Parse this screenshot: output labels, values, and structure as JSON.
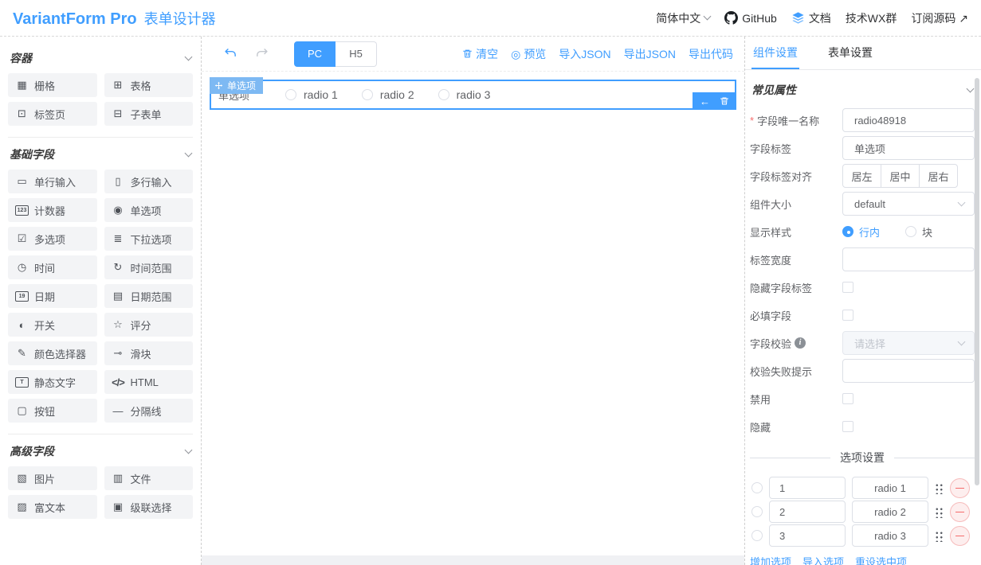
{
  "header": {
    "brand": "VariantForm Pro",
    "subtitle": "表单设计器",
    "language": "简体中文",
    "nav_github": "GitHub",
    "nav_docs": "文档",
    "nav_wx": "技术WX群",
    "nav_source": "订阅源码 ↗"
  },
  "sidebar": {
    "sections": [
      {
        "title": "容器",
        "items": [
          {
            "label": "栅格",
            "icon": "grid-icon"
          },
          {
            "label": "表格",
            "icon": "table-icon"
          },
          {
            "label": "标签页",
            "icon": "tabs-icon"
          },
          {
            "label": "子表单",
            "icon": "subform-icon"
          }
        ]
      },
      {
        "title": "基础字段",
        "items": [
          {
            "label": "单行输入",
            "icon": "input-icon"
          },
          {
            "label": "多行输入",
            "icon": "textarea-icon"
          },
          {
            "label": "计数器",
            "icon": "number-icon"
          },
          {
            "label": "单选项",
            "icon": "radio-icon"
          },
          {
            "label": "多选项",
            "icon": "checkbox-icon"
          },
          {
            "label": "下拉选项",
            "icon": "select-icon"
          },
          {
            "label": "时间",
            "icon": "time-icon"
          },
          {
            "label": "时间范围",
            "icon": "time-range-icon"
          },
          {
            "label": "日期",
            "icon": "date-icon"
          },
          {
            "label": "日期范围",
            "icon": "date-range-icon"
          },
          {
            "label": "开关",
            "icon": "switch-icon"
          },
          {
            "label": "评分",
            "icon": "rate-icon"
          },
          {
            "label": "颜色选择器",
            "icon": "color-picker-icon"
          },
          {
            "label": "滑块",
            "icon": "slider-icon"
          },
          {
            "label": "静态文字",
            "icon": "static-text-icon"
          },
          {
            "label": "HTML",
            "icon": "html-icon"
          },
          {
            "label": "按钮",
            "icon": "button-icon"
          },
          {
            "label": "分隔线",
            "icon": "divider-icon"
          }
        ]
      },
      {
        "title": "高级字段",
        "items": [
          {
            "label": "图片",
            "icon": "picture-icon"
          },
          {
            "label": "文件",
            "icon": "file-icon"
          },
          {
            "label": "富文本",
            "icon": "rich-editor-icon"
          },
          {
            "label": "级联选择",
            "icon": "cascader-icon"
          }
        ]
      }
    ]
  },
  "toolbar": {
    "device_tabs": [
      {
        "label": "PC",
        "active": true
      },
      {
        "label": "H5",
        "active": false
      }
    ],
    "clear": "清空",
    "preview": "预览",
    "import_json": "导入JSON",
    "export_json": "导出JSON",
    "export_code": "导出代码"
  },
  "canvas": {
    "widget": {
      "drag_badge": "单选项",
      "label": "单选项",
      "options": [
        {
          "label": "radio 1"
        },
        {
          "label": "radio 2"
        },
        {
          "label": "radio 3"
        }
      ]
    }
  },
  "inspector": {
    "tabs": [
      {
        "label": "组件设置",
        "active": true
      },
      {
        "label": "表单设置",
        "active": false
      }
    ],
    "section_title": "常见属性",
    "fields": {
      "unique_name": {
        "label": "字段唯一名称",
        "value": "radio48918",
        "required": true
      },
      "field_label": {
        "label": "字段标签",
        "value": "单选项"
      },
      "label_align": {
        "label": "字段标签对齐",
        "options": [
          {
            "label": "居左"
          },
          {
            "label": "居中"
          },
          {
            "label": "居右"
          }
        ]
      },
      "widget_size": {
        "label": "组件大小",
        "value": "default"
      },
      "display_style": {
        "label": "显示样式",
        "options": [
          {
            "label": "行内",
            "selected": true
          },
          {
            "label": "块",
            "selected": false
          }
        ]
      },
      "label_width": {
        "label": "标签宽度",
        "value": ""
      },
      "hide_label": {
        "label": "隐藏字段标签",
        "checked": false
      },
      "required_field": {
        "label": "必填字段",
        "checked": false
      },
      "validation": {
        "label": "字段校验",
        "placeholder": "请选择",
        "disabled": true
      },
      "validation_hint": {
        "label": "校验失败提示",
        "value": ""
      },
      "disabled": {
        "label": "禁用",
        "checked": false
      },
      "hidden": {
        "label": "隐藏",
        "checked": false
      }
    },
    "option_settings": {
      "title": "选项设置",
      "options": [
        {
          "value": "1",
          "label": "radio 1"
        },
        {
          "value": "2",
          "label": "radio 2"
        },
        {
          "value": "3",
          "label": "radio 3"
        }
      ],
      "links": [
        {
          "label": "增加选项"
        },
        {
          "label": "导入选项"
        },
        {
          "label": "重设选中项"
        }
      ]
    }
  },
  "colors": {
    "primary": "#409EFF",
    "danger": "#F56C6C",
    "text": "#606266",
    "border": "#DCDFE6"
  }
}
